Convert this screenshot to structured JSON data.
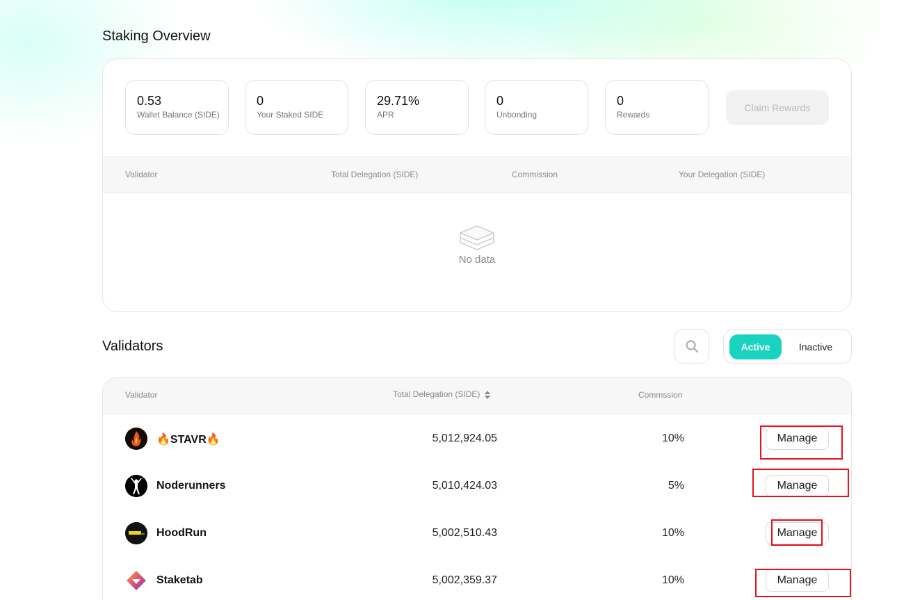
{
  "staking": {
    "title": "Staking Overview",
    "stats": [
      {
        "value": "0.53",
        "label": "Wallet Balance (SIDE)"
      },
      {
        "value": "0",
        "label": "Your Staked SIDE"
      },
      {
        "value": "29.71%",
        "label": "APR"
      },
      {
        "value": "0",
        "label": "Unbonding"
      },
      {
        "value": "0",
        "label": "Rewards"
      }
    ],
    "claim_label": "Claim Rewards",
    "columns": [
      "Validator",
      "Total Delegation (SIDE)",
      "Commission",
      "Your Delegation (SIDE)"
    ],
    "empty_label": "No data",
    "empty_icon": "empty-box-icon"
  },
  "validators": {
    "title": "Validators",
    "search_icon": "search-icon",
    "filter": {
      "active": "Active",
      "inactive": "Inactive"
    },
    "columns": [
      "Validator",
      "Total Delegation (SIDE)",
      "Commssion"
    ],
    "sort_icon": "sort-icon",
    "rows": [
      {
        "name": "🔥STAVR🔥",
        "delegation": "5,012,924.05",
        "commission": "10%",
        "action": "Manage",
        "icon": "stavr-avatar"
      },
      {
        "name": "Noderunners",
        "delegation": "5,010,424.03",
        "commission": "5%",
        "action": "Manage",
        "icon": "noderunners-avatar"
      },
      {
        "name": "HoodRun",
        "delegation": "5,002,510.43",
        "commission": "10%",
        "action": "Manage",
        "icon": "hoodrun-avatar"
      },
      {
        "name": "Staketab",
        "delegation": "5,002,359.37",
        "commission": "10%",
        "action": "Manage",
        "icon": "staketab-avatar"
      }
    ]
  },
  "colors": {
    "accent": "#19d3c1",
    "highlight": "#e8101a"
  }
}
